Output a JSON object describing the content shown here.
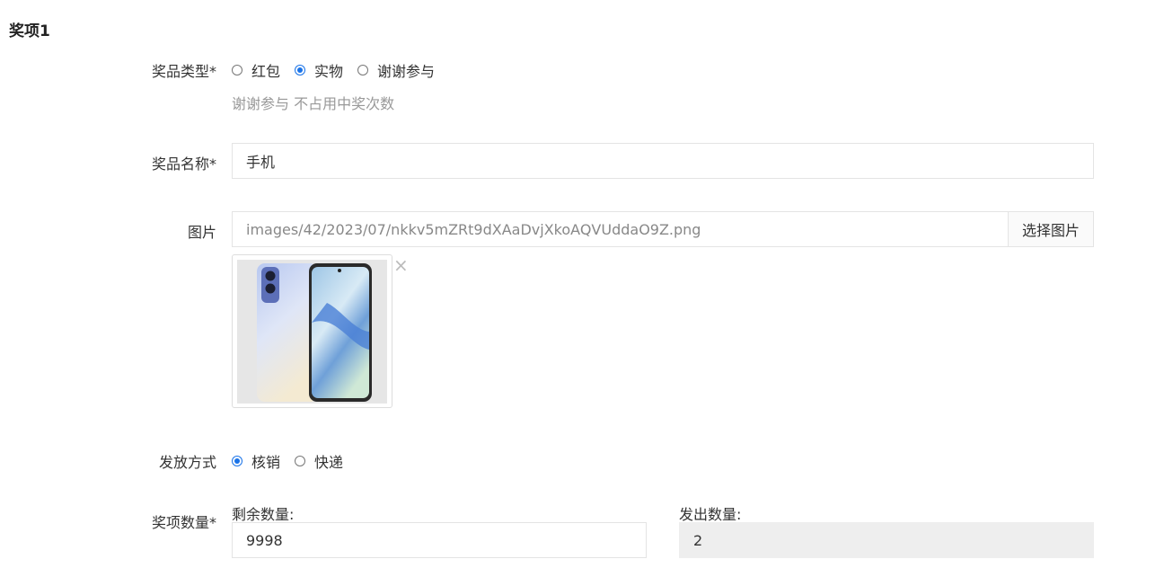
{
  "section": {
    "title": "奖项1"
  },
  "prize_type": {
    "label": "奖品类型*",
    "options": [
      {
        "label": "红包",
        "checked": false
      },
      {
        "label": "实物",
        "checked": true
      },
      {
        "label": "谢谢参与",
        "checked": false
      }
    ],
    "hint": "谢谢参与 不占用中奖次数"
  },
  "prize_name": {
    "label": "奖品名称*",
    "value": "手机"
  },
  "image": {
    "label": "图片",
    "path": "images/42/2023/07/nkkv5mZRt9dXAaDvjXkoAQVUddaO9Z.png",
    "select_button": "选择图片",
    "remove_icon": "close-icon",
    "close_glyph": "×"
  },
  "delivery": {
    "label": "发放方式",
    "options": [
      {
        "label": "核销",
        "checked": true
      },
      {
        "label": "快递",
        "checked": false
      }
    ]
  },
  "quantity": {
    "label": "奖项数量*",
    "remaining_label": "剩余数量:",
    "remaining_value": "9998",
    "issued_label": "发出数量:",
    "issued_value": "2"
  },
  "colors": {
    "accent": "#1a73e8",
    "hint": "#999999",
    "border": "#e4e4e4",
    "readonly_bg": "#eeeeee"
  }
}
